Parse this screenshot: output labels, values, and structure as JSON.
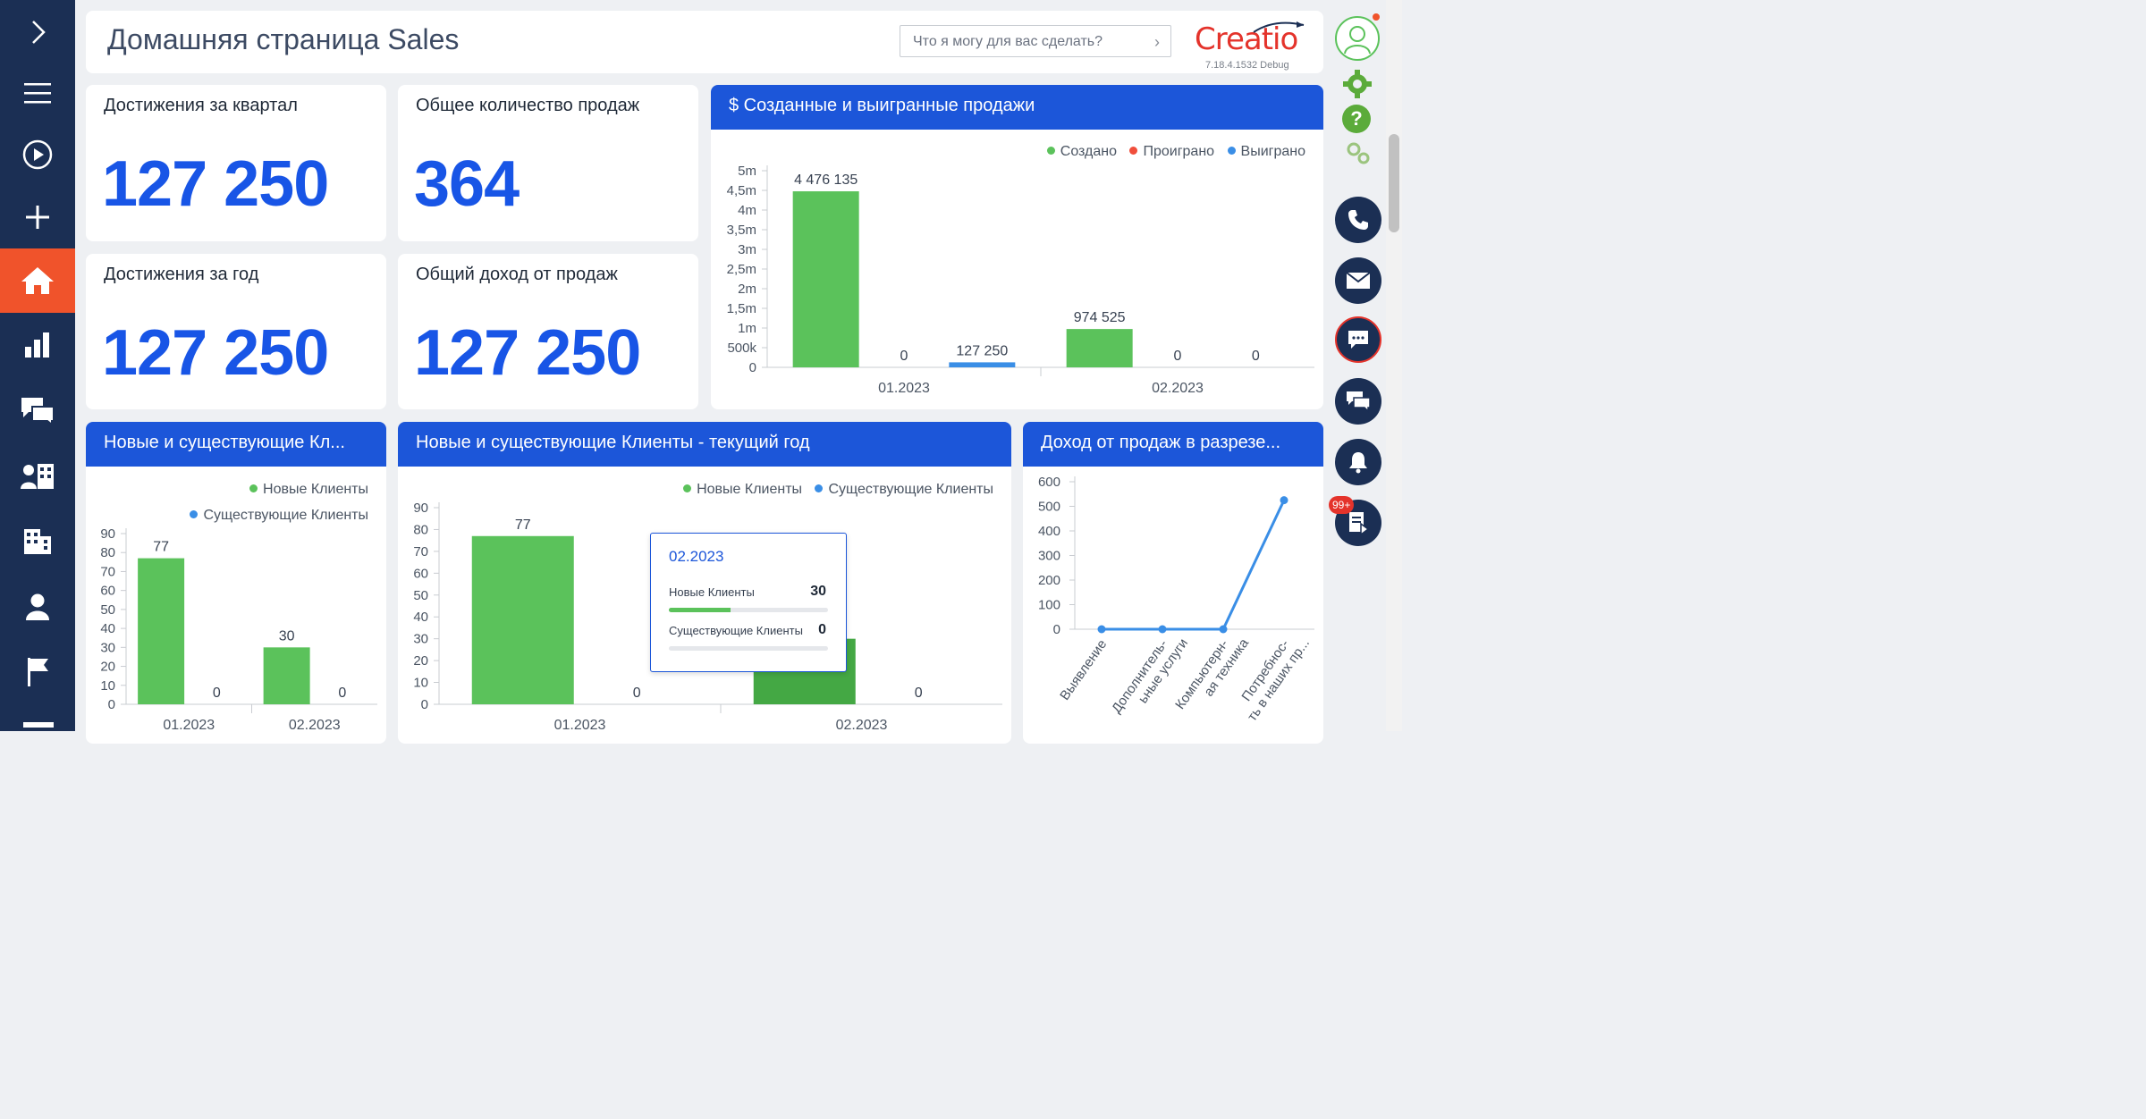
{
  "header": {
    "title": "Домашняя страница Sales",
    "search_placeholder": "Что я могу для вас сделать?",
    "logo": "Creatio",
    "version": "7.18.4.1532 Debug"
  },
  "nav": {
    "items": [
      "expand-icon",
      "menu-icon",
      "play-icon",
      "add-icon",
      "home-icon",
      "analytics-icon",
      "feed-icon",
      "contacts-icon",
      "accounts-icon",
      "user-icon",
      "flag-icon"
    ]
  },
  "right_panel": {
    "items": [
      "profile-avatar",
      "gear-icon",
      "help-icon",
      "settings-icon",
      "phone-icon",
      "email-icon",
      "chat-icon",
      "feed-icon",
      "notification-bell-icon",
      "tasks-icon"
    ],
    "tasks_badge": "99+"
  },
  "metrics": {
    "quarter": {
      "label": "Достижения за квартал",
      "value": "127 250"
    },
    "total_sales": {
      "label": "Общее количество продаж",
      "value": "364"
    },
    "year": {
      "label": "Достижения за год",
      "value": "127 250"
    },
    "revenue": {
      "label": "Общий доход от продаж",
      "value": "127 250"
    }
  },
  "colors": {
    "green": "#5bc25b",
    "red": "#f04e3b",
    "blue": "#3a8ee6",
    "header_blue": "#1c56d9",
    "nav": "#1b2f54",
    "active_nav": "#f0532b"
  },
  "panels": {
    "created_won": {
      "title": "$ Созданные и выигранные продажи",
      "legend": [
        "Создано",
        "Проиграно",
        "Выиграно"
      ]
    },
    "new_existing_short": {
      "title": "Новые и существующие Кл...",
      "legend": [
        "Новые Клиенты",
        "Существующие Клиенты"
      ]
    },
    "new_existing_year": {
      "title": "Новые и существующие Клиенты - текущий год",
      "legend": [
        "Новые Клиенты",
        "Существующие Клиенты"
      ]
    },
    "revenue_by": {
      "title": "Доход от продаж в разрезе..."
    }
  },
  "tooltip": {
    "title": "02.2023",
    "rows": [
      {
        "label": "Новые Клиенты",
        "value": "30",
        "fraction": 0.39
      },
      {
        "label": "Существующие Клиенты",
        "value": "0",
        "fraction": 0
      }
    ]
  },
  "chart_data": [
    {
      "type": "bar",
      "title": "$ Созданные и выигранные продажи",
      "categories": [
        "01.2023",
        "02.2023"
      ],
      "series": [
        {
          "name": "Создано",
          "values": [
            4476135,
            974525
          ],
          "labels": [
            "4 476 135",
            "974 525"
          ]
        },
        {
          "name": "Проиграно",
          "values": [
            0,
            0
          ],
          "labels": [
            "0",
            "0"
          ]
        },
        {
          "name": "Выиграно",
          "values": [
            127250,
            0
          ],
          "labels": [
            "127 250",
            "0"
          ]
        }
      ],
      "ylim": [
        0,
        5000000
      ],
      "yticks": [
        "0",
        "500k",
        "1m",
        "1,5m",
        "2m",
        "2,5m",
        "3m",
        "3,5m",
        "4m",
        "4,5m",
        "5m"
      ],
      "legend": "top-right"
    },
    {
      "type": "bar",
      "title": "Новые и существующие Кл...",
      "categories": [
        "01.2023",
        "02.2023"
      ],
      "series": [
        {
          "name": "Новые Клиенты",
          "values": [
            77,
            30
          ]
        },
        {
          "name": "Существующие Клиенты",
          "values": [
            0,
            0
          ]
        }
      ],
      "ylim": [
        0,
        90
      ],
      "yticks": [
        "0",
        "10",
        "20",
        "30",
        "40",
        "50",
        "60",
        "70",
        "80",
        "90"
      ],
      "legend": "top-right"
    },
    {
      "type": "bar",
      "title": "Новые и существующие Клиенты - текущий год",
      "categories": [
        "01.2023",
        "02.2023"
      ],
      "series": [
        {
          "name": "Новые Клиенты",
          "values": [
            77,
            30
          ]
        },
        {
          "name": "Существующие Клиенты",
          "values": [
            0,
            0
          ]
        }
      ],
      "ylim": [
        0,
        90
      ],
      "yticks": [
        "0",
        "10",
        "20",
        "30",
        "40",
        "50",
        "60",
        "70",
        "80",
        "90"
      ],
      "legend": "top-right"
    },
    {
      "type": "line",
      "title": "Доход от продаж в разрезе...",
      "categories": [
        "Выявление",
        "Дополнитель-ьные услуги",
        "Компьютерн-ая техника",
        "Потребнос-ть в наших пр..."
      ],
      "series": [
        {
          "values": [
            0,
            0,
            0,
            525
          ]
        }
      ],
      "ylim": [
        0,
        600
      ],
      "yticks": [
        "0",
        "100",
        "200",
        "300",
        "400",
        "500",
        "600"
      ]
    }
  ]
}
